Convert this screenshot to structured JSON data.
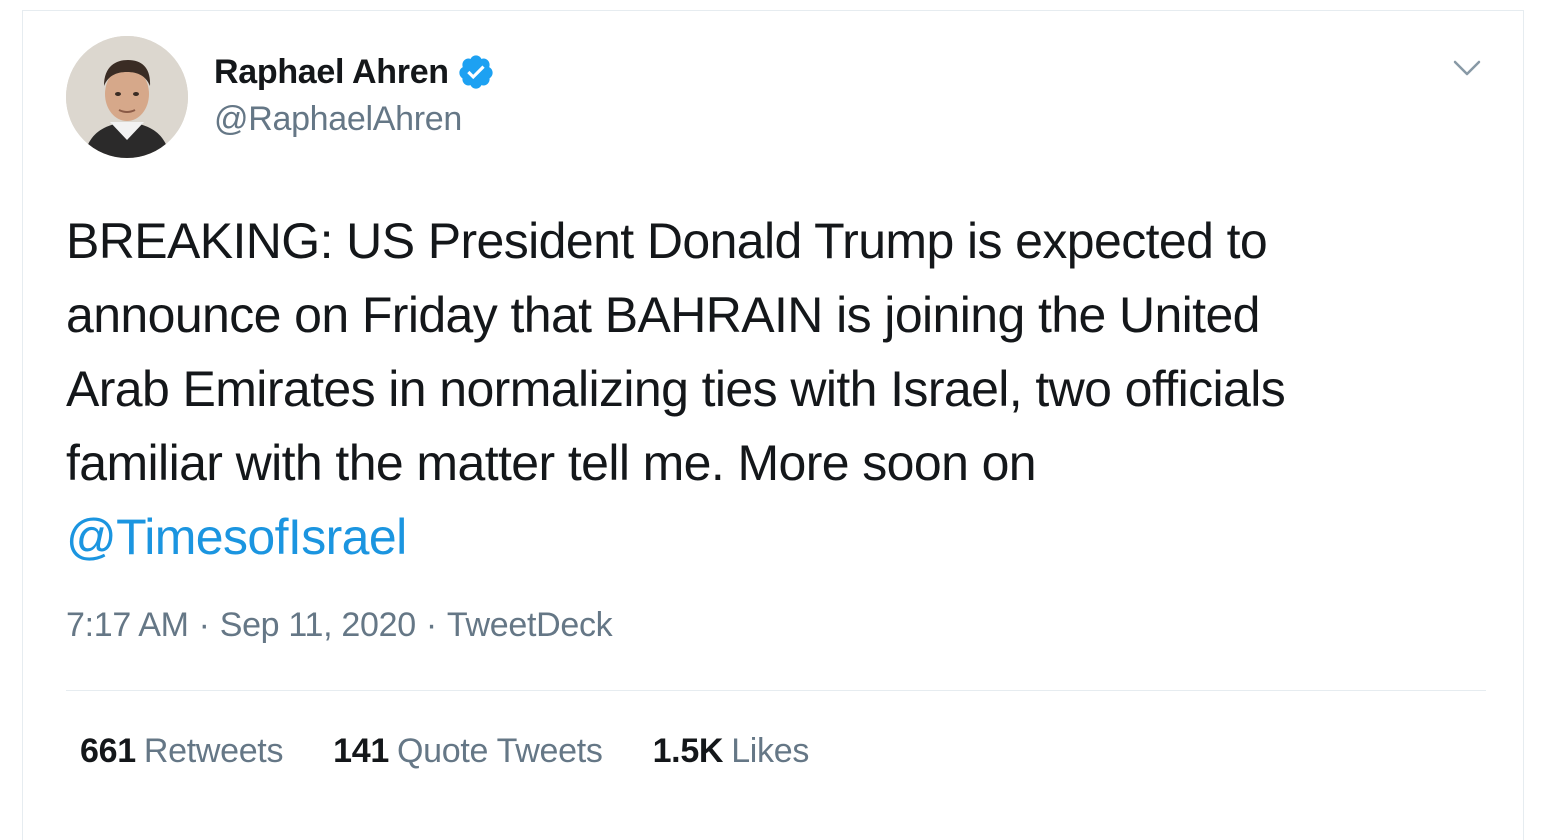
{
  "tweet": {
    "author": {
      "name": "Raphael Ahren",
      "handle": "@RaphaelAhren",
      "verified": true,
      "avatar_icon": "profile-photo"
    },
    "text": {
      "lines": [
        "BREAKING: US President Donald Trump is expected to",
        "announce on Friday that BAHRAIN is joining the United",
        "Arab Emirates in normalizing ties with Israel, two officials",
        "familiar with the matter tell me. More soon on"
      ],
      "mention": "@TimesofIsrael"
    },
    "meta": {
      "time": "7:17 AM",
      "separator": "·",
      "date": "Sep 11, 2020",
      "source": "TweetDeck"
    },
    "stats": {
      "retweets": {
        "count": "661",
        "label": "Retweets"
      },
      "quote_tweets": {
        "count": "141",
        "label": "Quote Tweets"
      },
      "likes": {
        "count": "1.5K",
        "label": "Likes"
      }
    }
  },
  "colors": {
    "text_primary": "#14171a",
    "text_secondary": "#657786",
    "link": "#1b95e0",
    "verified": "#1da1f2",
    "divider": "#e6ecf0"
  },
  "icons": {
    "verified": "verified-badge-icon",
    "caret": "chevron-down-icon"
  }
}
